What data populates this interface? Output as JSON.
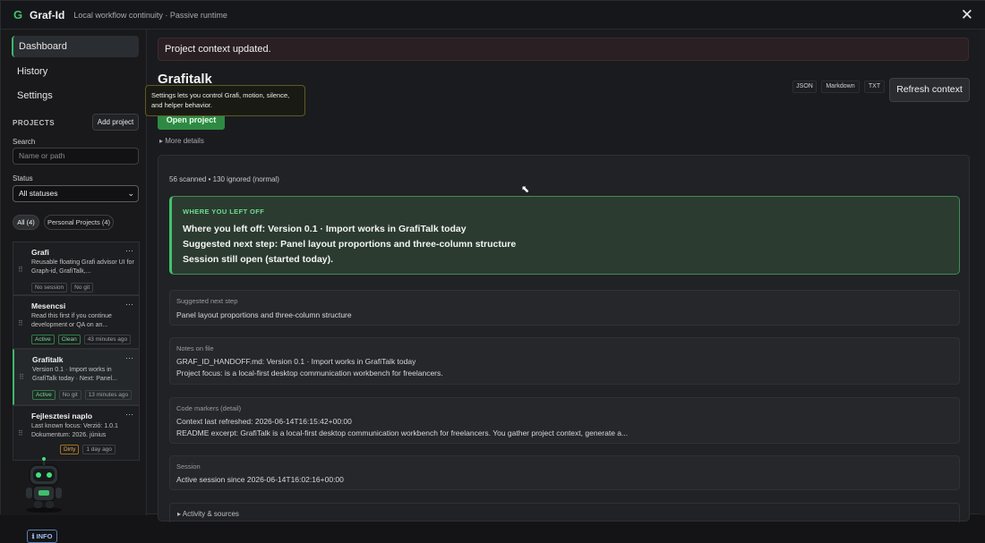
{
  "app": {
    "logo": "G",
    "name": "Graf-Id",
    "subtitle": "Local workflow continuity · Passive runtime",
    "close": "✕"
  },
  "sidebar": {
    "nav": [
      "Dashboard",
      "History",
      "Settings"
    ],
    "projects_label": "PROJECTS",
    "add_project": "Add project",
    "search_label": "Search",
    "search_placeholder": "Name or path",
    "status_label": "Status",
    "status_value": "All statuses",
    "filters": [
      "All (4)",
      "Personal Projects (4)"
    ],
    "projects": [
      {
        "title": "Grafi",
        "desc": "Reusable floating Grafi advisor UI for Graph-id, GrafiTalk,...",
        "badges": [
          "No session",
          "No git"
        ]
      },
      {
        "title": "Mesencsi",
        "desc": "Read this first if you continue development or QA on an...",
        "badges": [
          "Active",
          "Clean",
          "43 minutes ago"
        ]
      },
      {
        "title": "Grafitalk",
        "desc": "Version 0.1 · Import works in GrafiTalk today · Next: Panel...",
        "badges": [
          "Active",
          "No git",
          "13 minutes ago"
        ]
      },
      {
        "title": "Fejlesztesi naplo",
        "desc": "Last known focus: Verzió: 1.0.1 Dokumentum: 2026. június",
        "badges": [
          "Dirty",
          "1 day ago"
        ]
      }
    ],
    "info_button": "ℹ INFO"
  },
  "main": {
    "alert": "Project context updated.",
    "project_title": "Grafitalk",
    "tooltip": "Settings lets you control Grafi, motion, silence, and helper behavior.",
    "open_project": "Open project",
    "more_details": "▸ More details",
    "formats": [
      "JSON",
      "Markdown",
      "TXT"
    ],
    "refresh": "Refresh context",
    "scan_summary": "56 scanned • 130 ignored (normal)",
    "where": {
      "heading": "WHERE YOU LEFT OFF",
      "lines": [
        "Where you left off: Version 0.1 · Import works in GrafiTalk today",
        "Suggested next step: Panel layout proportions and three-column structure",
        "Session still open (started today)."
      ]
    },
    "suggested": {
      "label": "Suggested next step",
      "text": "Panel layout proportions and three-column structure"
    },
    "notes": {
      "label": "Notes on file",
      "lines": [
        "GRAF_ID_HANDOFF.md: Version 0.1 · Import works in GrafiTalk today",
        "Project focus: is a local-first desktop communication workbench for freelancers."
      ]
    },
    "code": {
      "label": "Code markers (detail)",
      "lines": [
        "Context last refreshed: 2026-06-14T16:15:42+00:00",
        "README excerpt: GrafiTalk is a local-first desktop communication workbench for freelancers. You gather project context, generate a..."
      ]
    },
    "session": {
      "label": "Session",
      "text": "Active session since 2026-06-14T16:02:16+00:00"
    },
    "activity": "▸ Activity & sources"
  },
  "colors": {
    "accent": "#3fb76a",
    "badge_green": "#6fdc8f",
    "badge_orange": "#e7a743"
  }
}
